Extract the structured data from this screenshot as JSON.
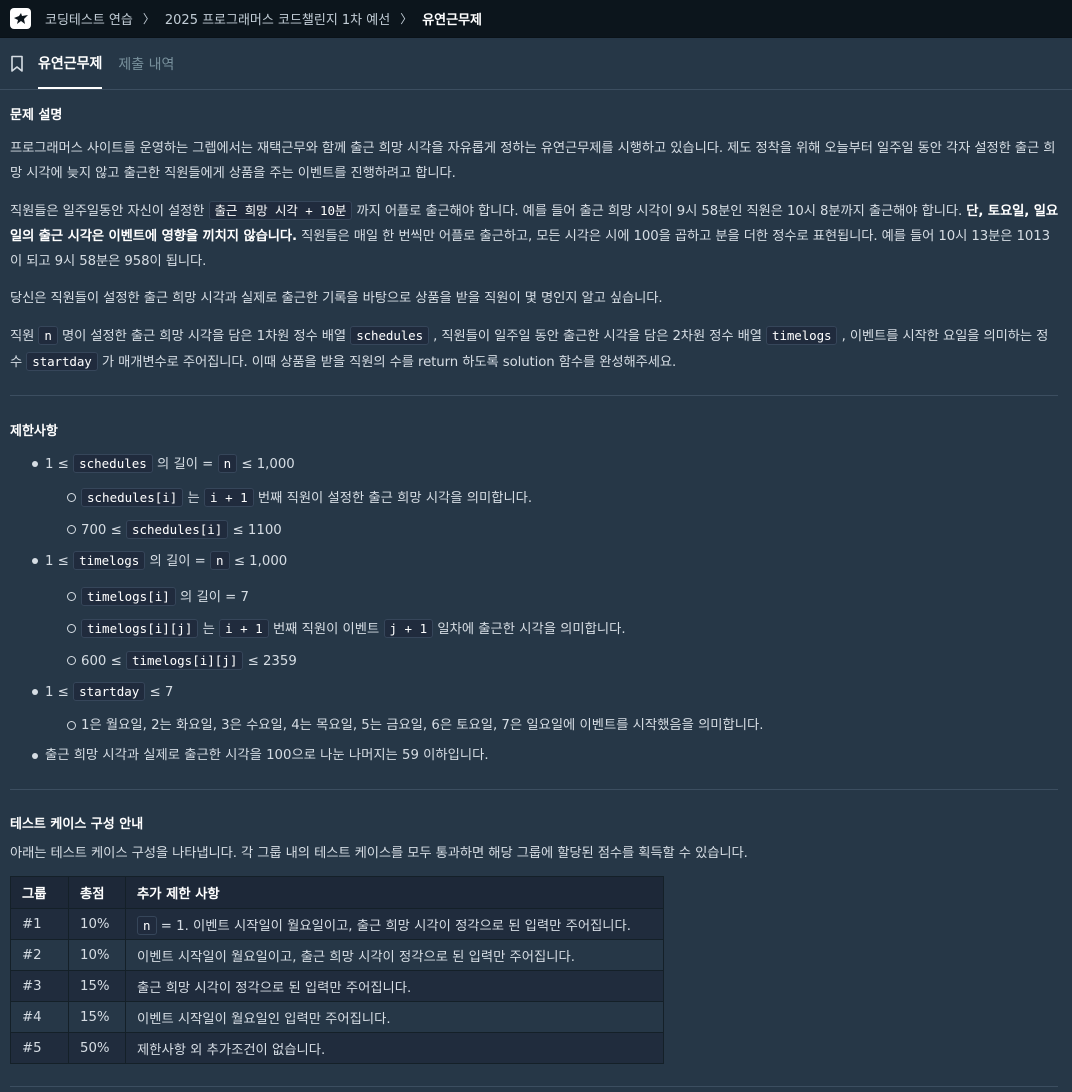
{
  "breadcrumb": [
    "코딩테스트 연습",
    "2025 프로그래머스 코드챌린지 1차 예선",
    "유연근무제"
  ],
  "tabs": {
    "active": "유연근무제",
    "inactive": "제출 내역"
  },
  "description": {
    "title": "문제 설명",
    "p1": "프로그래머스 사이트를 운영하는 그렙에서는 재택근무와 함께 출근 희망 시각을 자유롭게 정하는 유연근무제를 시행하고 있습니다. 제도 정착을 위해 오늘부터 일주일 동안 각자 설정한 출근 희망 시각에 늦지 않고 출근한 직원들에게 상품을 주는 이벤트를 진행하려고 합니다.",
    "p2_a": "직원들은 일주일동안 자신이 설정한",
    "p2_code": "출근 희망 시각 + 10분",
    "p2_b": "까지 어플로 출근해야 합니다. 예를 들어 출근 희망 시각이 9시 58분인 직원은 10시 8분까지 출근해야 합니다.",
    "p2_bold": "단, 토요일, 일요일의 출근 시각은 이벤트에 영향을 끼치지 않습니다.",
    "p2_c": "직원들은 매일 한 번씩만 어플로 출근하고, 모든 시각은 시에 100을 곱하고 분을 더한 정수로 표현됩니다. 예를 들어 10시 13분은 1013이 되고 9시 58분은 958이 됩니다.",
    "p3": "당신은 직원들이 설정한 출근 희망 시각과 실제로 출근한 기록을 바탕으로 상품을 받을 직원이 몇 명인지 알고 싶습니다.",
    "p4_a": "직원",
    "p4_n": "n",
    "p4_b": "명이 설정한 출근 희망 시각을 담은 1차원 정수 배열",
    "p4_schedules": "schedules",
    "p4_c": ", 직원들이 일주일 동안 출근한 시각을 담은 2차원 정수 배열",
    "p4_timelogs": "timelogs",
    "p4_d": ", 이벤트를 시작한 요일을 의미하는 정수",
    "p4_startday": "startday",
    "p4_e": "가 매개변수로 주어집니다. 이때 상품을 받을 직원의 수를 return 하도록 solution 함수를 완성해주세요."
  },
  "constraints": {
    "title": "제한사항",
    "c1": {
      "pre": "1 ≤",
      "code": "schedules",
      "mid": "의 길이 =",
      "n": "n",
      "post": "≤ 1,000"
    },
    "c1a": {
      "code": "schedules[i]",
      "mid": "는",
      "code2": "i + 1",
      "post": "번째 직원이 설정한 출근 희망 시각을 의미합니다."
    },
    "c1b": {
      "pre": "700 ≤",
      "code": "schedules[i]",
      "post": "≤ 1100"
    },
    "c2": {
      "pre": "1 ≤",
      "code": "timelogs",
      "mid": "의 길이 =",
      "n": "n",
      "post": "≤ 1,000"
    },
    "c2a": {
      "code": "timelogs[i]",
      "post": "의 길이 = 7"
    },
    "c2b": {
      "code": "timelogs[i][j]",
      "mid": "는",
      "code2": "i + 1",
      "mid2": "번째 직원이 이벤트",
      "code3": "j + 1",
      "post": "일차에 출근한 시각을 의미합니다."
    },
    "c2c": {
      "pre": "600 ≤",
      "code": "timelogs[i][j]",
      "post": "≤ 2359"
    },
    "c3": {
      "pre": "1 ≤",
      "code": "startday",
      "post": "≤ 7"
    },
    "c3a": "1은 월요일, 2는 화요일, 3은 수요일, 4는 목요일, 5는 금요일, 6은 토요일, 7은 일요일에 이벤트를 시작했음을 의미합니다.",
    "c4": "출근 희망 시각과 실제로 출근한 시각을 100으로 나눈 나머지는 59 이하입니다."
  },
  "testcases": {
    "title": "테스트 케이스 구성 안내",
    "desc": "아래는 테스트 케이스 구성을 나타냅니다. 각 그룹 내의 테스트 케이스를 모두 통과하면 해당 그룹에 할당된 점수를 획득할 수 있습니다.",
    "headers": [
      "그룹",
      "총점",
      "추가 제한 사항"
    ],
    "row1": {
      "group": "#1",
      "score": "10%",
      "code": "n",
      "text": "= 1. 이벤트 시작일이 월요일이고, 출근 희망 시각이 정각으로 된 입력만 주어집니다."
    },
    "row2": {
      "group": "#2",
      "score": "10%",
      "text": "이벤트 시작일이 월요일이고, 출근 희망 시각이 정각으로 된 입력만 주어집니다."
    },
    "row3": {
      "group": "#3",
      "score": "15%",
      "text": "출근 희망 시각이 정각으로 된 입력만 주어집니다."
    },
    "row4": {
      "group": "#4",
      "score": "15%",
      "text": "이벤트 시작일이 월요일인 입력만 주어집니다."
    },
    "row5": {
      "group": "#5",
      "score": "50%",
      "text": "제한사항 외 추가조건이 없습니다."
    }
  }
}
